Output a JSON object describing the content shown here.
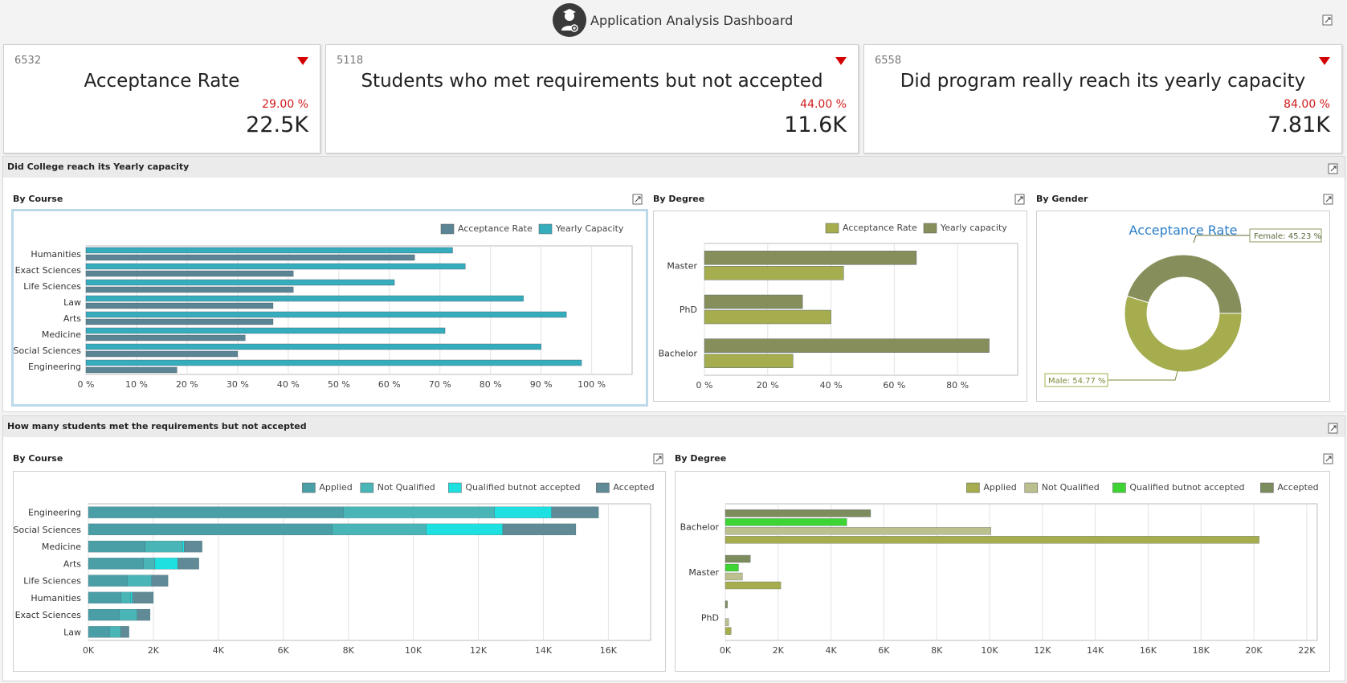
{
  "header": {
    "title": "Application Analysis Dashboard",
    "logo_icon": "student-avatar-icon"
  },
  "cards": [
    {
      "target": "6532",
      "title": "Acceptance Rate",
      "delta": "29.00 %",
      "value": "22.5K"
    },
    {
      "target": "5118",
      "title": "Students who met requirements but not accepted",
      "delta": "44.00 %",
      "value": "11.6K"
    },
    {
      "target": "6558",
      "title": "Did program really reach its yearly capacity",
      "delta": "84.00 %",
      "value": "7.81K"
    }
  ],
  "group1": {
    "title": "Did College reach its Yearly capacity",
    "by_course": "By Course",
    "by_degree": "By Degree",
    "by_gender": "By Gender"
  },
  "group2": {
    "title": "How many students met the requirements but not accepted",
    "by_course": "By Course",
    "by_degree": "By Degree"
  },
  "colors": {
    "teal": "#36adbd",
    "slate": "#5b8594",
    "olive_light": "#a5ad4e",
    "olive_dark": "#868f5c",
    "applied": "#4a9ea6",
    "not_qualified": "#4ab5b6",
    "qual_not_acc": "#1ee0e0",
    "accepted": "#5f8a96",
    "d_applied": "#a5ad4e",
    "d_not_qualified": "#bcc08e",
    "d_qual_not_acc": "#3ed434",
    "d_accepted": "#7c8c5c",
    "negative": "#d11a1a"
  },
  "chart_data": [
    {
      "type": "bar",
      "title": "By Course",
      "orientation": "horizontal",
      "categories": [
        "Humanities",
        "Exact Sciences",
        "Life Sciences",
        "Law",
        "Arts",
        "Medicine",
        "Social Sciences",
        "Engineering"
      ],
      "series": [
        {
          "name": "Yearly Capacity",
          "values": [
            72.5,
            75,
            61,
            86.5,
            95,
            71,
            90,
            98
          ]
        },
        {
          "name": "Acceptance Rate",
          "values": [
            65,
            41,
            41,
            37,
            37,
            31.5,
            30,
            18
          ]
        }
      ],
      "xlim": [
        0,
        108
      ],
      "xticks": [
        "0 %",
        "10 %",
        "20 %",
        "30 %",
        "40 %",
        "50 %",
        "60 %",
        "70 %",
        "80 %",
        "90 %",
        "100 %"
      ],
      "legend": [
        "Acceptance Rate",
        "Yearly Capacity"
      ]
    },
    {
      "type": "bar",
      "title": "By Degree",
      "orientation": "horizontal",
      "categories": [
        "Master",
        "PhD",
        "Bachelor"
      ],
      "series": [
        {
          "name": "Yearly capacity",
          "values": [
            67,
            31,
            90
          ]
        },
        {
          "name": "Acceptance Rate",
          "values": [
            44,
            40,
            28
          ]
        }
      ],
      "xlim": [
        0,
        99
      ],
      "xticks": [
        "0 %",
        "20 %",
        "40 %",
        "60 %",
        "80 %"
      ],
      "legend": [
        "Acceptance Rate",
        "Yearly capacity"
      ]
    },
    {
      "type": "pie",
      "title": "Acceptance Rate",
      "slices": [
        {
          "label": "Female: 45.23 %",
          "value": 45.23
        },
        {
          "label": "Male: 54.77 %",
          "value": 54.77
        }
      ]
    },
    {
      "type": "bar",
      "title": "By Course",
      "orientation": "horizontal",
      "stacked": true,
      "categories": [
        "Engineering",
        "Social Sciences",
        "Medicine",
        "Arts",
        "Life Sciences",
        "Humanities",
        "Exact Sciences",
        "Law"
      ],
      "series": [
        {
          "name": "Applied",
          "values": [
            7850,
            7500,
            1750,
            1700,
            1200,
            1000,
            950,
            650
          ]
        },
        {
          "name": "Not Qualified",
          "values": [
            4650,
            2900,
            1150,
            350,
            750,
            300,
            550,
            350
          ]
        },
        {
          "name": "Qualified but not accepted",
          "values": [
            1750,
            2350,
            50,
            700,
            0,
            50,
            0,
            0
          ]
        },
        {
          "name": "Accepted",
          "values": [
            1450,
            2250,
            550,
            650,
            500,
            650,
            400,
            250
          ]
        }
      ],
      "xlim": [
        0,
        17300
      ],
      "xticks": [
        "0K",
        "2K",
        "4K",
        "6K",
        "8K",
        "10K",
        "12K",
        "14K",
        "16K"
      ],
      "legend": [
        "Applied",
        "Not Qualified",
        "Qualified butnot accepted",
        "Accepted"
      ]
    },
    {
      "type": "bar",
      "title": "By Degree",
      "orientation": "horizontal",
      "categories": [
        "Bachelor",
        "Master",
        "PhD"
      ],
      "series": [
        {
          "name": "Accepted",
          "values": [
            5500,
            950,
            80
          ]
        },
        {
          "name": "Qualified but not accepted",
          "values": [
            4600,
            500,
            0
          ]
        },
        {
          "name": "Not Qualified",
          "values": [
            10050,
            650,
            130
          ]
        },
        {
          "name": "Applied",
          "values": [
            20200,
            2100,
            220
          ]
        }
      ],
      "xlim": [
        0,
        22400
      ],
      "xticks": [
        "0K",
        "2K",
        "4K",
        "6K",
        "8K",
        "10K",
        "12K",
        "14K",
        "16K",
        "18K",
        "20K",
        "22K"
      ],
      "legend": [
        "Applied",
        "Not Qualified",
        "Qualified butnot accepted",
        "Accepted"
      ]
    }
  ]
}
